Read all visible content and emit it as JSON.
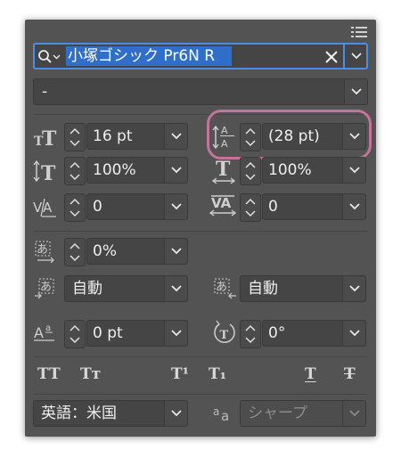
{
  "font": {
    "name": "小塚ゴシック Pr6N R",
    "style": "-"
  },
  "size": {
    "font_size": "16 pt",
    "leading": "(28 pt)"
  },
  "scale": {
    "vertical": "100%",
    "horizontal": "100%"
  },
  "kerning": {
    "kerning": "0",
    "tracking": "0"
  },
  "tsume": {
    "value": "0%"
  },
  "aki": {
    "before": "自動",
    "after": "自動"
  },
  "baseline": {
    "shift": "0 pt",
    "rotation": "0°"
  },
  "language": {
    "value": "英語：米国",
    "antialias": "シャープ"
  },
  "style_buttons": {
    "all_caps": "TT",
    "small_caps": "Tт",
    "superscript": "T¹",
    "subscript": "T₁",
    "underline": "T",
    "strikethrough": "T"
  },
  "colors": {
    "panel": "#535353",
    "field": "#454545",
    "accent": "#c4739a",
    "selection": "#2f6ec9",
    "focus": "#4a8fe7"
  },
  "icons": [
    "panel-menu-icon",
    "search-icon",
    "clear-icon",
    "chevron-down-icon",
    "stepper-icon",
    "font-size-icon",
    "leading-icon",
    "vertical-scale-icon",
    "horizontal-scale-icon",
    "kerning-icon",
    "tracking-icon",
    "tsume-icon",
    "aki-before-icon",
    "aki-after-icon",
    "baseline-shift-icon",
    "rotation-icon",
    "antialias-icon"
  ]
}
